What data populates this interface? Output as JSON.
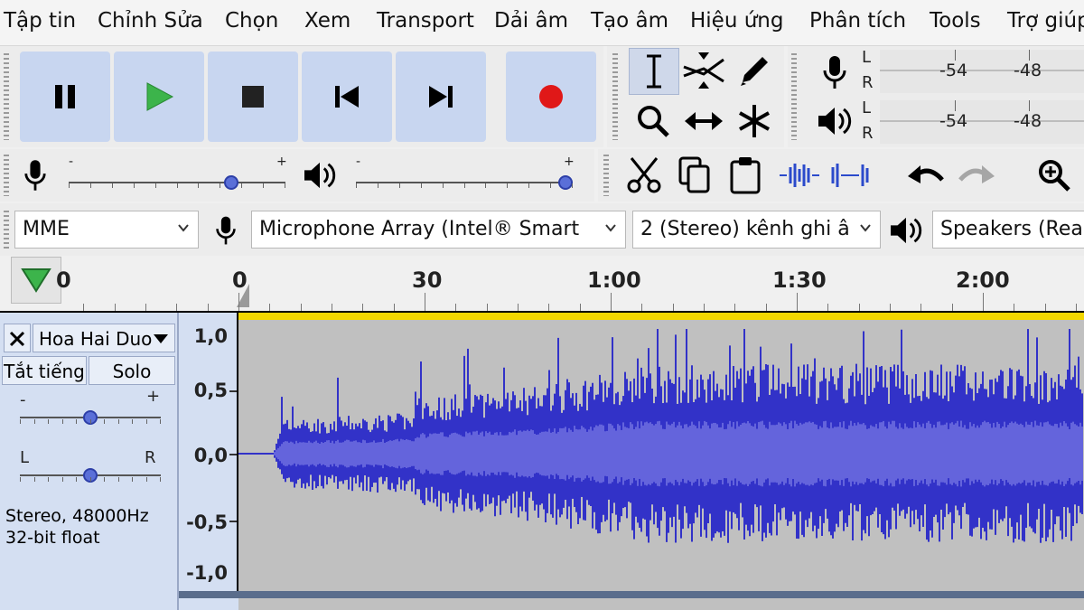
{
  "menu": [
    "Tập tin",
    "Chỉnh Sửa",
    "Chọn",
    "Xem",
    "Transport",
    "Dải âm",
    "Tạo âm",
    "Hiệu ứng",
    "Phân tích",
    "Tools",
    "Trợ giúp"
  ],
  "transport": {
    "icons": [
      "pause-icon",
      "play-icon",
      "stop-icon",
      "skip-to-start-icon",
      "skip-to-end-icon",
      "record-icon"
    ],
    "colors": {
      "play": "#3cb44b",
      "record": "#e01818",
      "button_bg": "#c8d6f0"
    }
  },
  "meters": {
    "rec": {
      "l": "L",
      "r": "R",
      "ticks": [
        "-54",
        "-48"
      ]
    },
    "play": {
      "l": "L",
      "r": "R",
      "ticks": [
        "-54",
        "-48"
      ]
    }
  },
  "mixer": {
    "rec_minus": "-",
    "rec_plus": "+",
    "rec_level": 0.77,
    "play_minus": "-",
    "play_plus": "+",
    "play_level": 1.0
  },
  "device": {
    "host": "MME",
    "input": "Microphone Array (Intel® Smart",
    "channels": "2 (Stereo) kênh ghi â",
    "output": "Speakers (Realt"
  },
  "timeline": {
    "labels": [
      "0",
      "0",
      "30",
      "1:00",
      "1:30",
      "2:00"
    ]
  },
  "track": {
    "name": "Hoa Hai Duo",
    "mute": "Tắt tiếng",
    "solo": "Solo",
    "gain_minus": "-",
    "gain_plus": "+",
    "pan_l": "L",
    "pan_r": "R",
    "gain_level": 0.5,
    "pan_level": 0.5,
    "info_line1": "Stereo, 48000Hz",
    "info_line2": "32-bit float",
    "wave_color": "#3232c8",
    "wave_rms_color": "#6464dc"
  },
  "yaxis": {
    "labels": [
      "1,0",
      "0,5",
      "0,0",
      "-0,5",
      "-1,0"
    ]
  }
}
